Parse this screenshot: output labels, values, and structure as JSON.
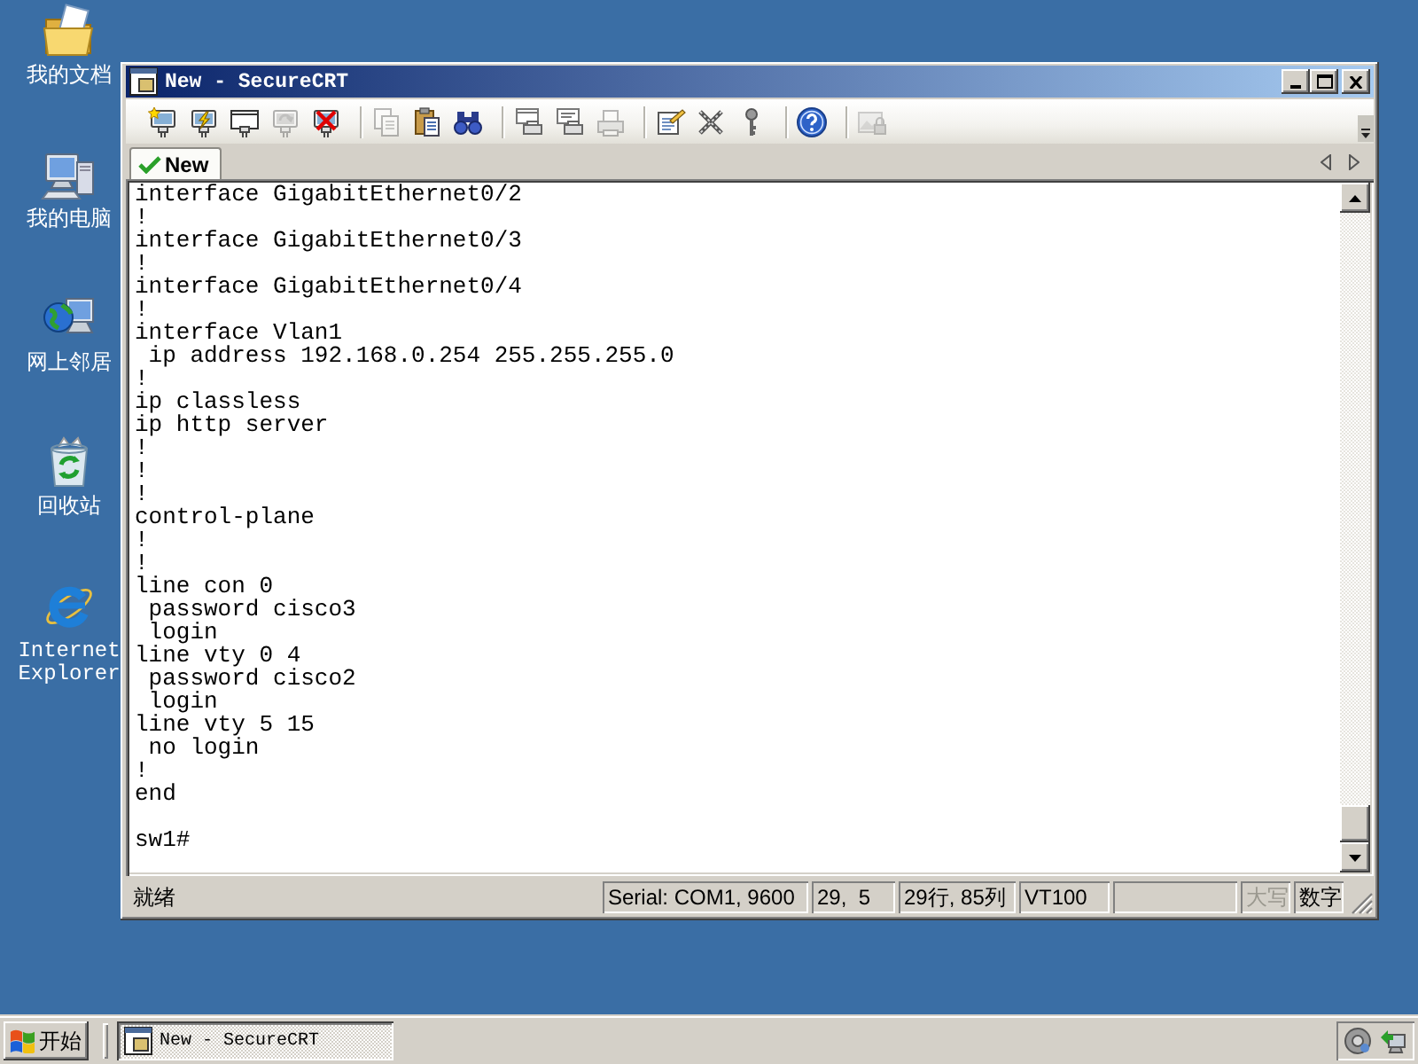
{
  "desktop": {
    "shortcuts": [
      {
        "label": "我的文档"
      },
      {
        "label": "我的电脑"
      },
      {
        "label": "网上邻居"
      },
      {
        "label": "回收站"
      },
      {
        "label": "Internet Explorer"
      }
    ]
  },
  "window": {
    "title": "New - SecureCRT"
  },
  "toolbar": {
    "groups": [
      {
        "buttons": [
          {
            "disabled": false
          },
          {
            "disabled": false
          },
          {
            "disabled": false
          },
          {
            "disabled": true
          },
          {
            "disabled": false
          }
        ]
      },
      {
        "buttons": [
          {
            "disabled": true
          },
          {
            "disabled": false
          },
          {
            "disabled": false
          }
        ]
      },
      {
        "buttons": [
          {
            "disabled": false
          },
          {
            "disabled": false
          },
          {
            "disabled": true
          }
        ]
      },
      {
        "buttons": [
          {
            "disabled": false
          },
          {
            "disabled": false
          },
          {
            "disabled": false
          }
        ]
      },
      {
        "buttons": [
          {
            "disabled": false
          }
        ]
      },
      {
        "buttons": [
          {
            "disabled": true
          }
        ]
      }
    ]
  },
  "tab_bar": {
    "tabs": [
      {
        "label": "New",
        "selected": true,
        "connected": true
      }
    ]
  },
  "terminal": {
    "lines": [
      "interface GigabitEthernet0/2",
      "!",
      "interface GigabitEthernet0/3",
      "!",
      "interface GigabitEthernet0/4",
      "!",
      "interface Vlan1",
      " ip address 192.168.0.254 255.255.255.0",
      "!",
      "ip classless",
      "ip http server",
      "!",
      "!",
      "!",
      "control-plane",
      "!",
      "!",
      "line con 0",
      " password cisco3",
      " login",
      "line vty 0 4",
      " password cisco2",
      " login",
      "line vty 5 15",
      " no login",
      "!",
      "end"
    ],
    "prompt": "sw1#"
  },
  "status_bar": {
    "message": "就绪",
    "panes": [
      "Serial: COM1, 9600",
      "29,  5",
      "29行, 85列",
      "VT100"
    ],
    "indicators": [
      {
        "label": "大写",
        "on": false
      },
      {
        "label": "数字",
        "on": true
      }
    ]
  },
  "taskbar": {
    "start_label": "开始",
    "tasks": [
      {
        "label": "New - SecureCRT",
        "selected": true
      }
    ]
  }
}
